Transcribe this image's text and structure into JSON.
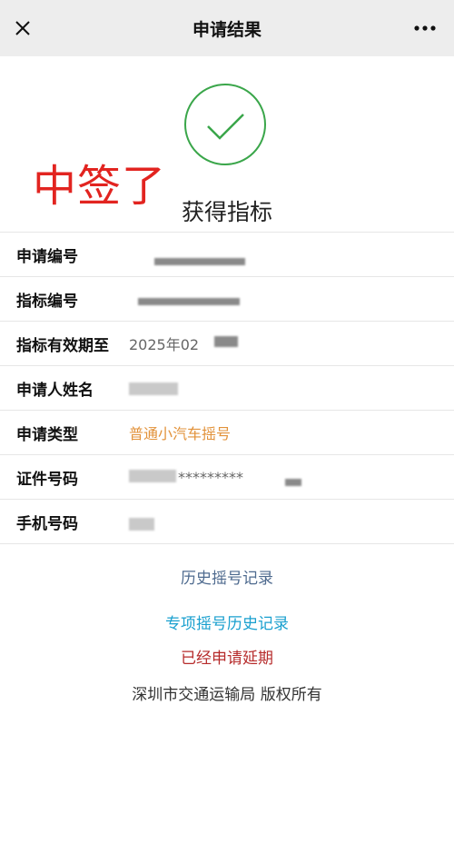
{
  "header": {
    "title": "申请结果",
    "close_icon": "close-icon",
    "more_icon": "more-icon"
  },
  "result": {
    "icon": "check-circle-icon",
    "annotation": "中签了",
    "title": "获得指标"
  },
  "rows": [
    {
      "label": "申请编号",
      "value": ""
    },
    {
      "label": "指标编号",
      "value": ""
    },
    {
      "label": "指标有效期至",
      "value": "2025年02"
    },
    {
      "label": "申请人姓名",
      "value": ""
    },
    {
      "label": "申请类型",
      "value": "普通小汽车摇号"
    },
    {
      "label": "证件号码",
      "value": "*********"
    },
    {
      "label": "手机号码",
      "value": ""
    }
  ],
  "links": {
    "history": "历史摇号记录",
    "special_history": "专项摇号历史记录"
  },
  "status_text": "已经申请延期",
  "footer": {
    "copyright": "深圳市交通运输局 版权所有"
  },
  "colors": {
    "accent_orange": "#e2923a",
    "success_green": "#3aa64a",
    "annotation_red": "#e22420",
    "link_blue": "#1aa0cf",
    "status_red": "#b62b2b"
  }
}
